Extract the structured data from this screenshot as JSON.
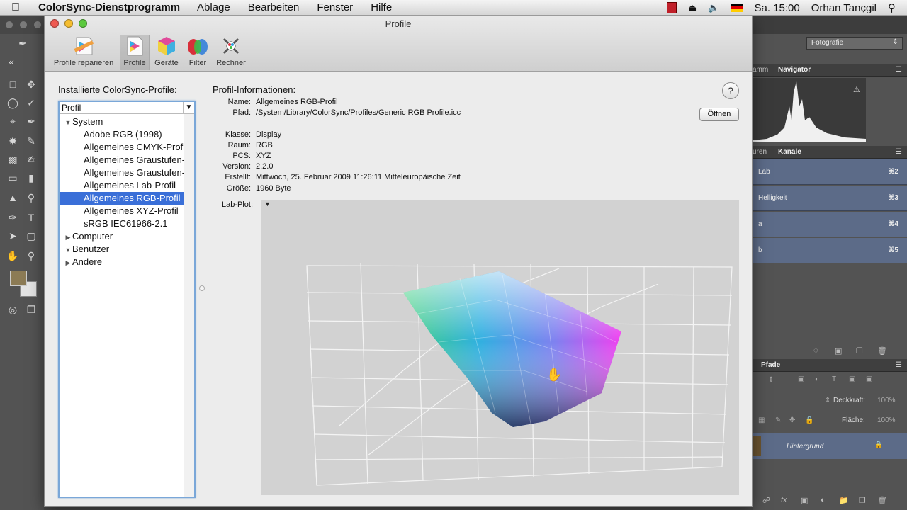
{
  "menubar": {
    "apple": "",
    "app_name": "ColorSync-Dienstprogramm",
    "menus": [
      "Ablage",
      "Bearbeiten",
      "Fenster",
      "Hilfe"
    ],
    "clock": "Sa. 15:00",
    "user": "Orhan Tançgil"
  },
  "window": {
    "title": "Profile",
    "toolbar": [
      {
        "label": "Profile reparieren",
        "icon": "repair-profiles-icon"
      },
      {
        "label": "Profile",
        "icon": "profiles-icon"
      },
      {
        "label": "Geräte",
        "icon": "devices-cube-icon"
      },
      {
        "label": "Filter",
        "icon": "filter-icon"
      },
      {
        "label": "Rechner",
        "icon": "calculator-icon"
      }
    ],
    "selected_toolbar": "Profile"
  },
  "profiles": {
    "heading": "Installierte ColorSync-Profile:",
    "column_header": "Profil",
    "tree": [
      {
        "label": "System",
        "level": 0,
        "expanded": true
      },
      {
        "label": "Adobe RGB (1998)",
        "level": 1
      },
      {
        "label": "Allgemeines CMYK-Profil",
        "level": 1
      },
      {
        "label": "Allgemeines Graustufen-",
        "level": 1
      },
      {
        "label": "Allgemeines Graustufen-",
        "level": 1
      },
      {
        "label": "Allgemeines Lab-Profil",
        "level": 1
      },
      {
        "label": "Allgemeines RGB-Profil",
        "level": 1,
        "selected": true
      },
      {
        "label": "Allgemeines XYZ-Profil",
        "level": 1
      },
      {
        "label": "sRGB IEC61966-2.1",
        "level": 1
      },
      {
        "label": "Computer",
        "level": 0,
        "expanded": false
      },
      {
        "label": "Benutzer",
        "level": 0,
        "expanded": true
      },
      {
        "label": "Andere",
        "level": 0,
        "expanded": false
      }
    ]
  },
  "info": {
    "heading": "Profil-Informationen:",
    "help": "?",
    "open_button": "Öffnen",
    "rows": [
      {
        "key": "Name:",
        "value": "Allgemeines RGB-Profil"
      },
      {
        "key": "Pfad:",
        "value": "/System/Library/ColorSync/Profiles/Generic RGB Profile.icc"
      },
      {
        "key": "Klasse:",
        "value": "Display"
      },
      {
        "key": "Raum:",
        "value": "RGB"
      },
      {
        "key": "PCS:",
        "value": "XYZ"
      },
      {
        "key": "Version:",
        "value": "2.2.0"
      },
      {
        "key": "Erstellt:",
        "value": "Mittwoch, 25. Februar 2009 11:26:11 Mitteleuropäische Zeit"
      },
      {
        "key": "Größe:",
        "value": "1960 Byte"
      }
    ],
    "labplot_label": "Lab-Plot:"
  },
  "photoshop": {
    "workspace": "Fotografie",
    "tabs_top": [
      "amm",
      "Navigator"
    ],
    "tabs_mid": [
      "uren",
      "Kanäle"
    ],
    "channels": [
      {
        "name": "Lab",
        "shortcut": "⌘2"
      },
      {
        "name": "Helligkeit",
        "shortcut": "⌘3"
      },
      {
        "name": "a",
        "shortcut": "⌘4"
      },
      {
        "name": "b",
        "shortcut": "⌘5"
      }
    ],
    "tab_layers": "Pfade",
    "opacity_label": "Deckkraft:",
    "opacity_value": "100%",
    "fill_label": "Fläche:",
    "fill_value": "100%",
    "layer_name": "Hintergrund"
  }
}
